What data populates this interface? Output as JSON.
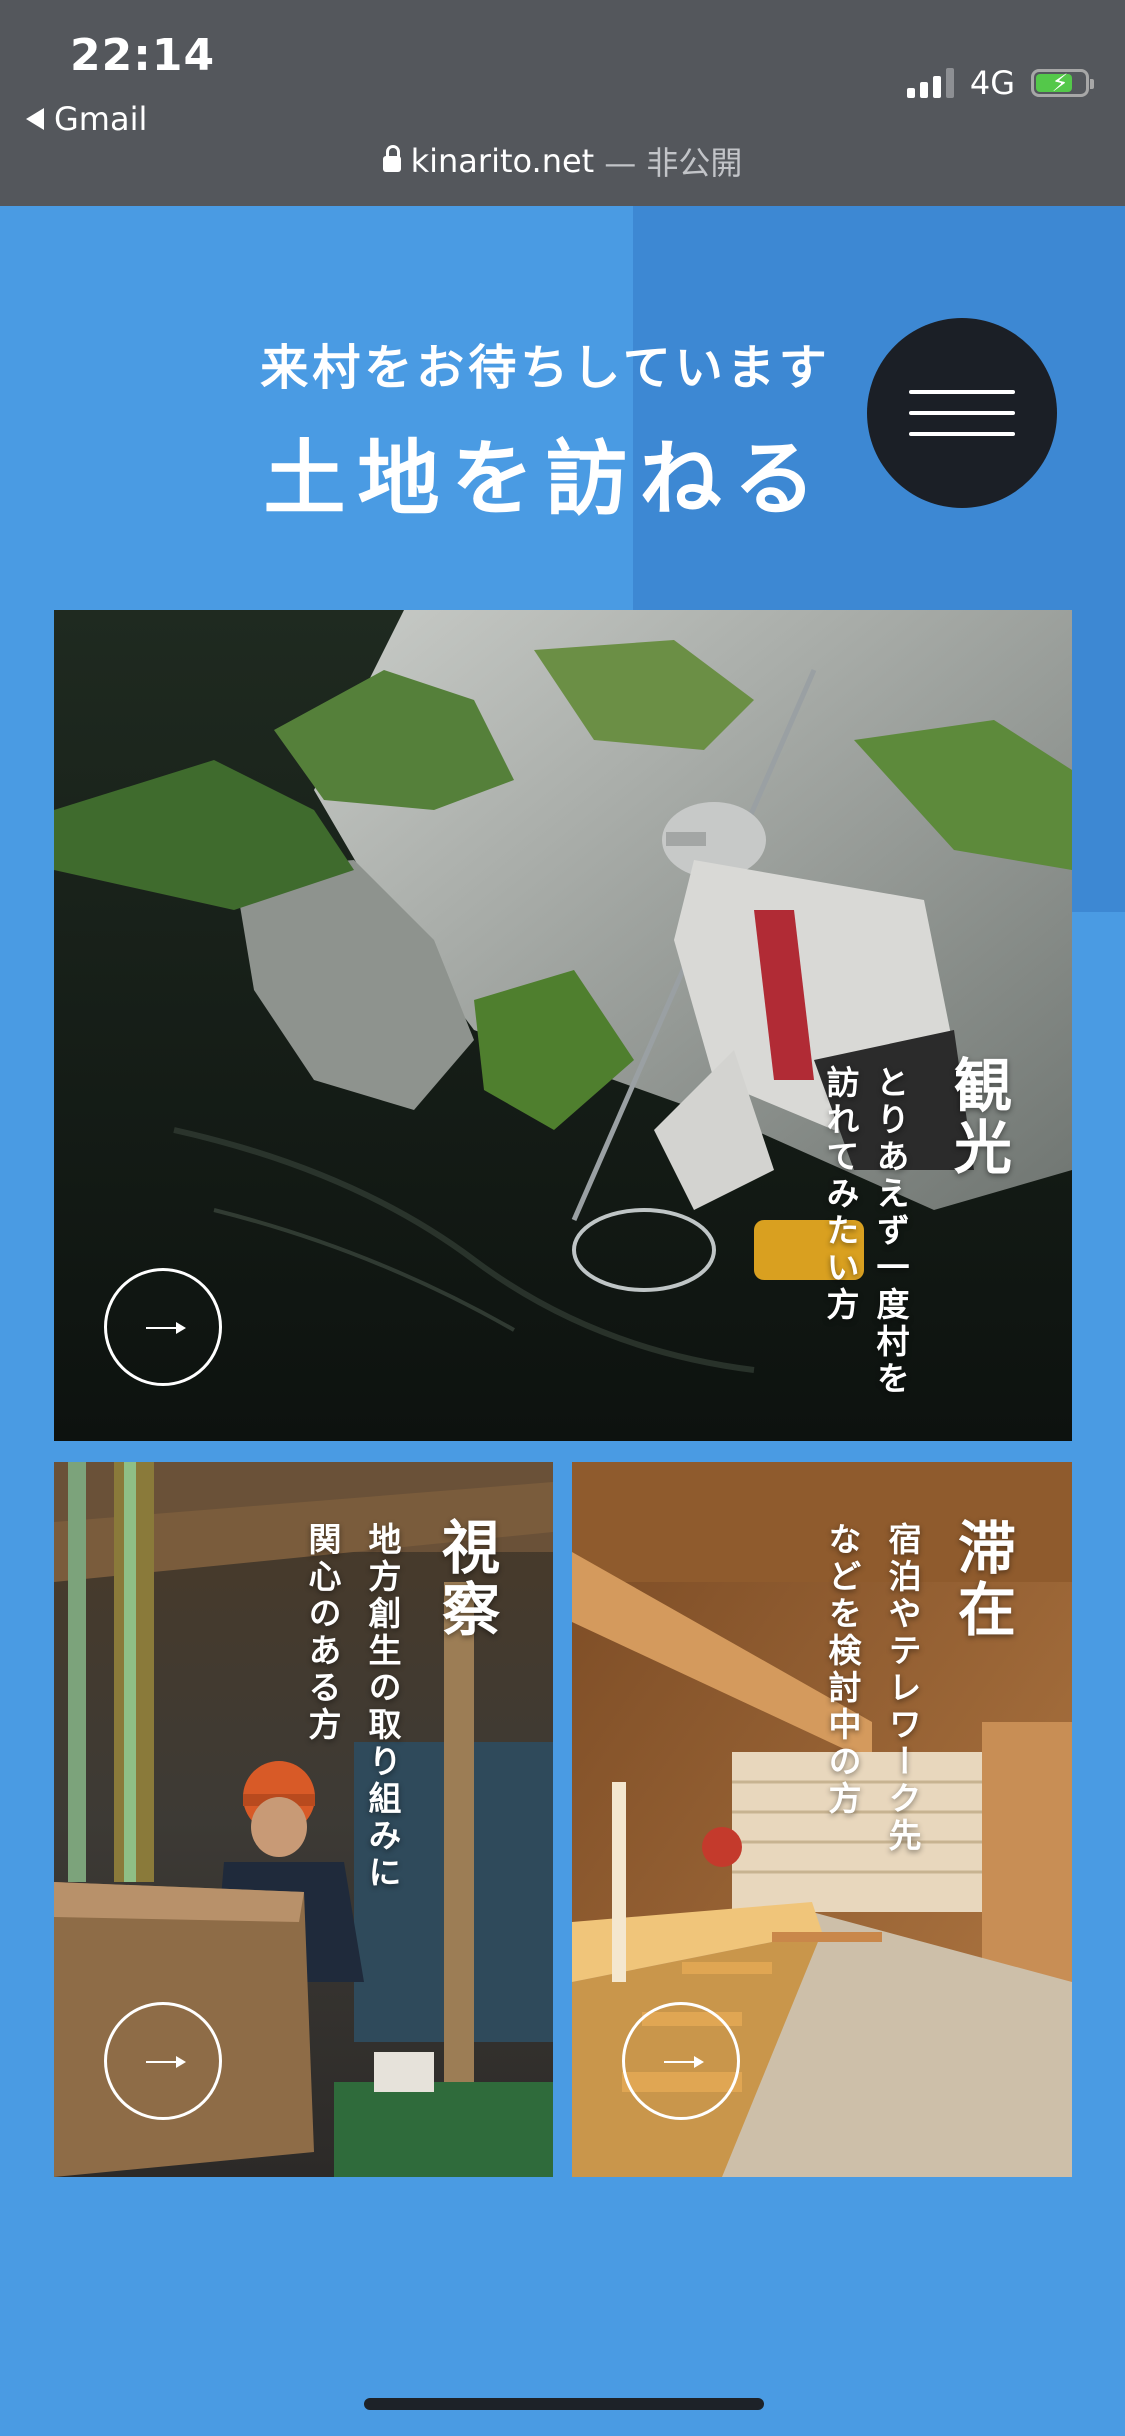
{
  "status_bar": {
    "time": "22:14",
    "back_label": "Gmail",
    "network": "4G",
    "battery_level": 0.75,
    "battery_color": "#54c84a"
  },
  "browser": {
    "domain": "kinarito.net",
    "privacy": "— 非公開"
  },
  "hero": {
    "subtitle": "来村をお待ちしています",
    "title": "土地を訪ねる",
    "menu_icon": "hamburger-icon"
  },
  "cards": [
    {
      "title": "観光",
      "desc_line1": "とりあえず一度村を",
      "desc_line2": "訪れてみたい方",
      "arrow": "→"
    },
    {
      "title": "視察",
      "desc_line1": "地方創生の取り組みに",
      "desc_line2": "関心のある方",
      "arrow": "→"
    },
    {
      "title": "滞在",
      "desc_line1": "宿泊やテレワーク先",
      "desc_line2": "などを検討中の方",
      "arrow": "→"
    }
  ],
  "colors": {
    "page_background": "#4a9be3",
    "accent_panel": "#3d88d3",
    "menu_button": "#1b1f26",
    "chrome": "#54575c"
  }
}
